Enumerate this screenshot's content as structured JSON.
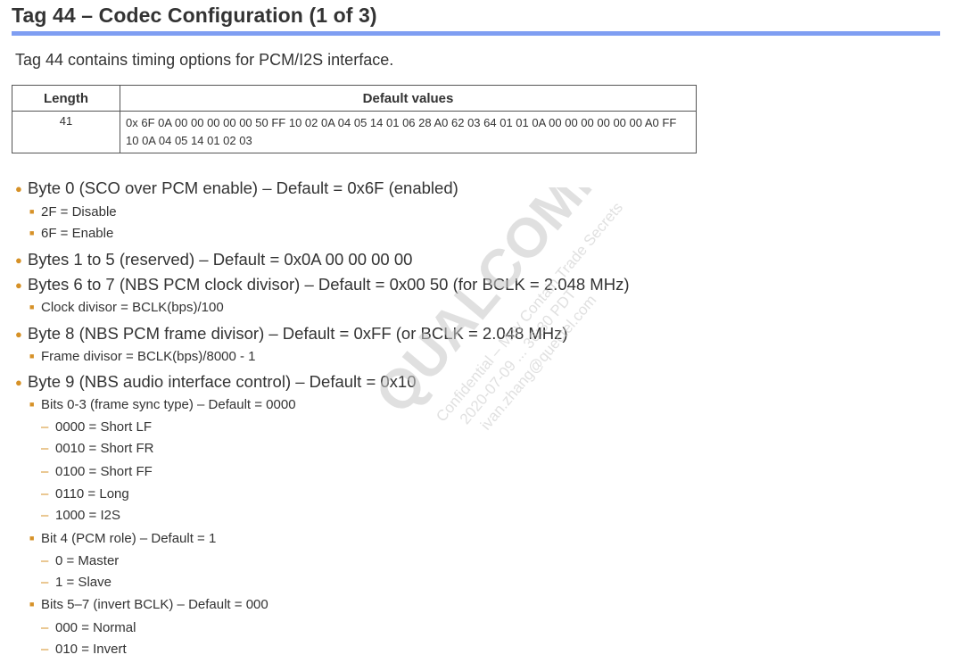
{
  "title": "Tag 44 – Codec Configuration (1 of 3)",
  "intro": "Tag 44 contains timing options for PCM/I2S interface.",
  "table": {
    "headers": [
      "Length",
      "Default values"
    ],
    "row": {
      "length": "41",
      "values": "0x 6F 0A 00 00 00 00 00 50 FF 10 02 0A 04 05 14 01 06 28 A0 62 03 64 01 01 0A 00 00 00 00 00 00 A0 FF 10 0A 04 05 14 01 02 03"
    }
  },
  "list": [
    {
      "level": 1,
      "text": "Byte 0 (SCO over PCM enable) – Default = 0x6F (enabled)"
    },
    {
      "level": 2,
      "text": "2F = Disable"
    },
    {
      "level": 2,
      "text": "6F = Enable"
    },
    {
      "level": 1,
      "text": "Bytes 1 to 5 (reserved) – Default = 0x0A 00 00 00 00"
    },
    {
      "level": 1,
      "text": "Bytes 6 to 7 (NBS PCM clock divisor) – Default = 0x00 50 (for BCLK = 2.048 MHz)"
    },
    {
      "level": 2,
      "text": "Clock divisor = BCLK(bps)/100"
    },
    {
      "level": 1,
      "text": "Byte 8 (NBS PCM frame divisor) – Default = 0xFF (or BCLK = 2.048 MHz)"
    },
    {
      "level": 2,
      "text": "Frame divisor = BCLK(bps)/8000 - 1"
    },
    {
      "level": 1,
      "text": "Byte 9 (NBS audio interface control) – Default = 0x10"
    },
    {
      "level": 2,
      "text": "Bits 0-3 (frame sync type) – Default = 0000"
    },
    {
      "level": 3,
      "text": "0000 = Short LF"
    },
    {
      "level": 3,
      "text": "0010 = Short FR"
    },
    {
      "level": 3,
      "text": "0100 = Short FF"
    },
    {
      "level": 3,
      "text": "0110 = Long"
    },
    {
      "level": 3,
      "text": "1000 = I2S"
    },
    {
      "level": 2,
      "text": "Bit 4 (PCM role) – Default = 1"
    },
    {
      "level": 3,
      "text": "0 = Master"
    },
    {
      "level": 3,
      "text": "1 = Slave"
    },
    {
      "level": 2,
      "text": "Bits 5–7 (invert BCLK) – Default = 000"
    },
    {
      "level": 3,
      "text": "000 = Normal"
    },
    {
      "level": 3,
      "text": "010 = Invert"
    }
  ],
  "bullets": {
    "level1": "●",
    "level2": "■",
    "level3": "–"
  },
  "watermark": {
    "logo": "QUALCOMM",
    "lines": [
      "Confidential – May Contain Trade Secrets",
      "2020-07-09 ... 36:30 PDT",
      "ivan.zhang@quectel.com"
    ]
  },
  "colors": {
    "accent_rule": "#7f9ef2",
    "bullet": "#d69127",
    "text": "#333333"
  }
}
